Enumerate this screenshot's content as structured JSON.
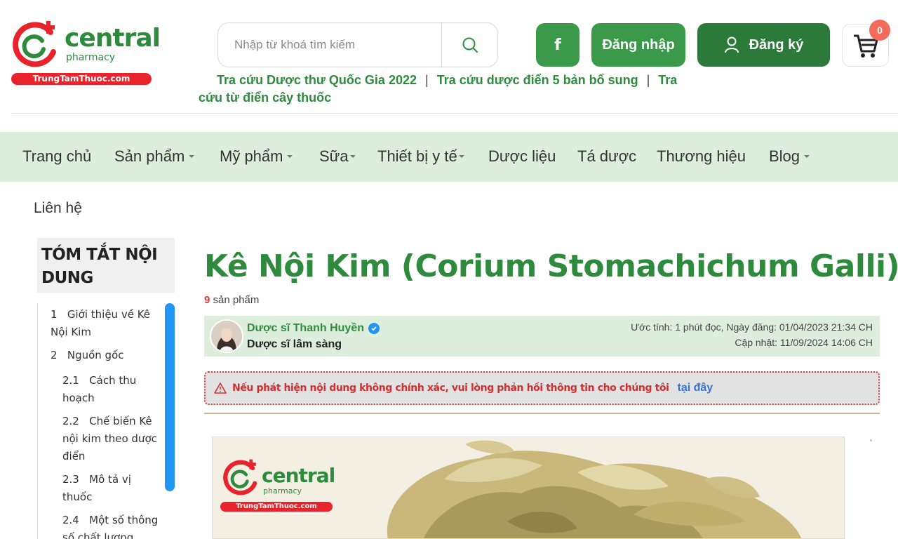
{
  "header": {
    "logo": {
      "word": "central",
      "sub": "pharmacy",
      "bar": "TrungTamThuoc.com"
    },
    "search": {
      "placeholder": "Nhập từ khoá tìm kiếm"
    },
    "facebook_label": "f",
    "login_label": "Đăng nhập",
    "register_label": "Đăng ký",
    "cart_count": "0",
    "quick_links": [
      "Tra cứu Dược thư Quốc Gia 2022",
      "Tra cứu dược điển 5 bản bổ sung",
      "Tra cứu từ điển cây thuốc"
    ],
    "quick_links_sep": "|"
  },
  "nav": {
    "items": [
      {
        "label": "Trang chủ"
      },
      {
        "label": "Sản phẩm"
      },
      {
        "label": "Mỹ phẩm"
      },
      {
        "label": "Sữa"
      },
      {
        "label": "Thiết bị y tế"
      },
      {
        "label": "Dược liệu"
      },
      {
        "label": "Tá dược"
      },
      {
        "label": "Thương hiệu"
      },
      {
        "label": "Blog"
      }
    ],
    "contact": "Liên hệ"
  },
  "toc": {
    "title": "TÓM TẮT NỘI DUNG",
    "items": [
      {
        "num": "1",
        "text": "Giới thiệu về Kê Nội Kim"
      },
      {
        "num": "2",
        "text": "Nguồn gốc"
      },
      {
        "num": "2.1",
        "text": "Cách thu hoạch"
      },
      {
        "num": "2.2",
        "text": "Chế biến Kê nội kim theo dược điển"
      },
      {
        "num": "2.3",
        "text": "Mô tả vị thuốc"
      },
      {
        "num": "2.4",
        "text": "Một số thông số chất lượng"
      }
    ]
  },
  "article": {
    "title": "Kê Nội Kim (Corium Stomachichum Galli)",
    "product_count": "9",
    "product_label": "sản phẩm",
    "author": {
      "name": "Dược sĩ Thanh Huyền",
      "role": "Dược sĩ lâm sàng",
      "meta_line1": "Ước tính: 1 phút đọc, Ngày đăng: 01/04/2023 21:34 CH",
      "meta_line2": "Cập nhật: 11/09/2024 14:06 CH"
    },
    "warning": {
      "text": "Nếu phát hiện nội dung không chính xác, vui lòng phản hồi thông tin cho chúng tôi",
      "link": "tại đây"
    },
    "hero_logo": {
      "word": "central",
      "sub": "pharmacy",
      "bar": "TrungTamThuoc.com"
    }
  },
  "colors": {
    "brand_green": "#2e8b3e",
    "nav_bg": "#ddeedd",
    "brand_red": "#e8232c",
    "toc_scroll": "#2196f3"
  }
}
